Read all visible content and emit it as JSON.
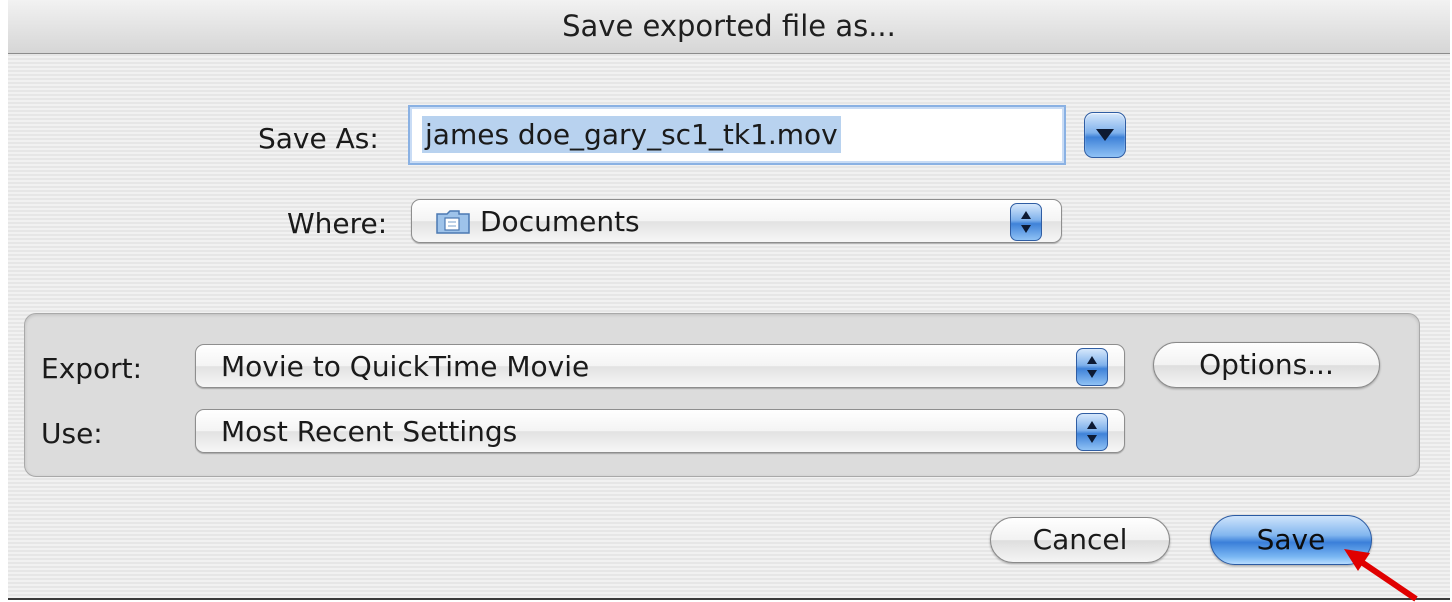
{
  "dialog": {
    "title": "Save exported file as...",
    "save_as_label": "Save As:",
    "save_as_value": "james doe_gary_sc1_tk1.mov",
    "where_label": "Where:",
    "where_value": "Documents",
    "where_icon": "folder-icon",
    "export_label": "Export:",
    "export_value": "Movie to QuickTime Movie",
    "use_label": "Use:",
    "use_value": "Most Recent Settings",
    "options_label": "Options...",
    "cancel_label": "Cancel",
    "save_label": "Save"
  },
  "colors": {
    "accent": "#3f82d8",
    "annotation_arrow": "#e00000"
  }
}
